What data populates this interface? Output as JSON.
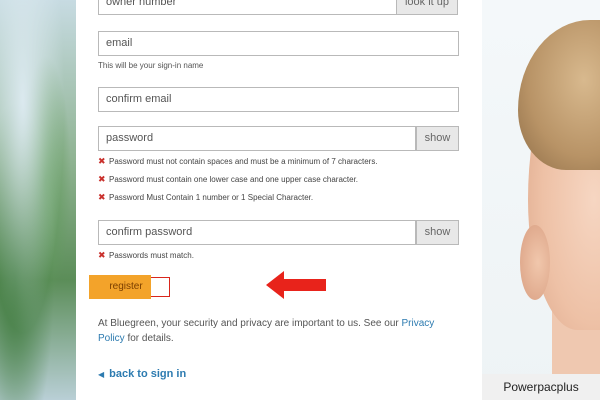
{
  "form": {
    "owner_number_placeholder": "owner number",
    "lookup_label": "look it up",
    "email_placeholder": "email",
    "email_hint": "This will be your sign-in name",
    "confirm_email_placeholder": "confirm email",
    "password_placeholder": "password",
    "password_show_label": "show",
    "password_errors": [
      "Password must not contain spaces and must be a minimum of 7 characters.",
      "Password must contain one lower case and one upper case character.",
      "Password Must Contain 1 number or 1 Special Character."
    ],
    "confirm_password_placeholder": "confirm password",
    "confirm_password_show_label": "show",
    "confirm_password_error": "Passwords must match.",
    "register_label": "register",
    "privacy_text": "At Bluegreen, your security and privacy are important to us. See our ",
    "privacy_link": "Privacy Policy",
    "privacy_suffix": " for details.",
    "back_link": "back to sign in",
    "back_icon": "chevron-left-icon",
    "error_icon": "x-mark-icon"
  },
  "annotation": {
    "arrow_color": "#e8231b",
    "highlight_color": "#f3a32a",
    "box_color": "#d9261c"
  },
  "watermark": "Powerpacplus"
}
